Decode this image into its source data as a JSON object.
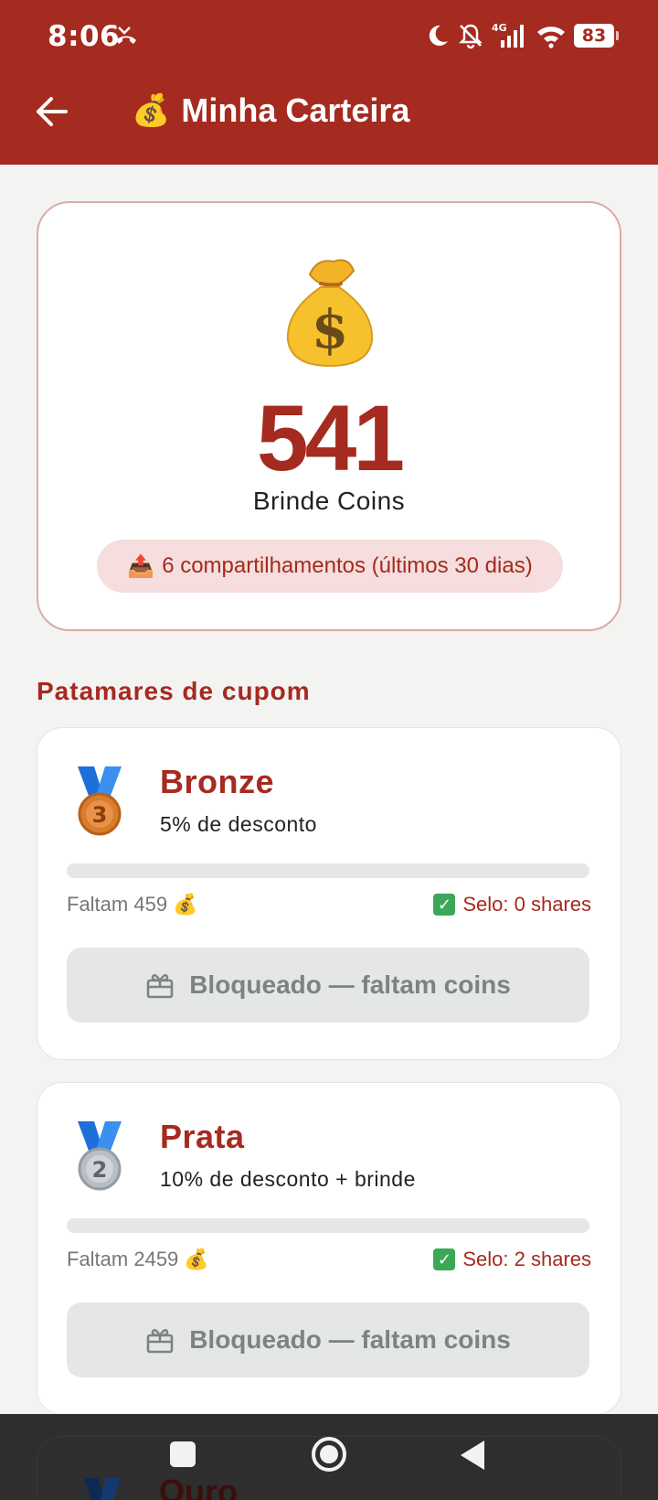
{
  "status_bar": {
    "time": "8:06",
    "battery": "83",
    "network": "4G"
  },
  "app_bar": {
    "title_emoji": "💰",
    "title": "Minha Carteira"
  },
  "wallet": {
    "icon": "money-bag-icon",
    "bag_emoji": "💰",
    "balance": "541",
    "currency_label": "Brinde Coins",
    "shares_emoji": "📤",
    "shares_text": "6 compartilhamentos (últimos 30 dias)"
  },
  "section_title": "Patamares de cupom",
  "tiers": [
    {
      "name": "Bronze",
      "medal_number": "3",
      "description": "5% de desconto",
      "remaining": "Faltam 459",
      "remaining_emoji": "💰",
      "seal": "Selo: 0 shares",
      "progress": 0,
      "button": "Bloqueado — faltam coins"
    },
    {
      "name": "Prata",
      "medal_number": "2",
      "description": "10% de desconto + brinde",
      "remaining": "Faltam 2459",
      "remaining_emoji": "💰",
      "seal": "Selo: 2 shares",
      "progress": 0,
      "button": "Bloqueado — faltam coins"
    },
    {
      "name": "Ouro"
    }
  ],
  "colors": {
    "primary": "#a52a1f",
    "background": "#f3f3f2",
    "disabled_button": "#e5e7e5",
    "disabled_text": "#7c847f"
  }
}
